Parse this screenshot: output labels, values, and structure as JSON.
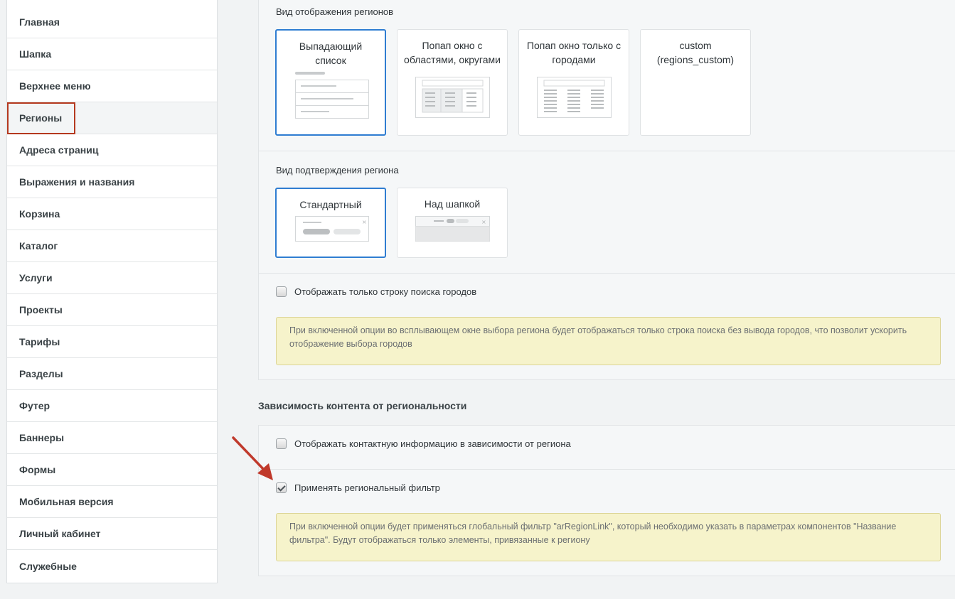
{
  "sidebar": {
    "items": [
      {
        "label": "Главная"
      },
      {
        "label": "Шапка"
      },
      {
        "label": "Верхнее меню"
      },
      {
        "label": "Регионы"
      },
      {
        "label": "Адреса страниц"
      },
      {
        "label": "Выражения и названия"
      },
      {
        "label": "Корзина"
      },
      {
        "label": "Каталог"
      },
      {
        "label": "Услуги"
      },
      {
        "label": "Проекты"
      },
      {
        "label": "Тарифы"
      },
      {
        "label": "Разделы"
      },
      {
        "label": "Футер"
      },
      {
        "label": "Баннеры"
      },
      {
        "label": "Формы"
      },
      {
        "label": "Мобильная версия"
      },
      {
        "label": "Личный кабинет"
      },
      {
        "label": "Служебные"
      }
    ],
    "active": "Регионы"
  },
  "region_view": {
    "label": "Вид отображения регионов",
    "options": [
      {
        "title": "Выпадающий список",
        "selected": true
      },
      {
        "title": "Попап окно с областями, округами",
        "selected": false
      },
      {
        "title": "Попап окно только с городами",
        "selected": false
      },
      {
        "title": "custom (regions_custom)",
        "selected": false
      }
    ]
  },
  "region_confirm": {
    "label": "Вид подтверждения региона",
    "options": [
      {
        "title": "Стандартный",
        "selected": true
      },
      {
        "title": "Над шапкой",
        "selected": false
      }
    ]
  },
  "search_only": {
    "label": "Отображать только строку поиска городов",
    "checked": false,
    "note": "При включенной опции во всплывающем окне выбора региона будет отображаться только строка поиска без вывода городов, что позволит ускорить отображение выбора городов"
  },
  "content_section": {
    "title": "Зависимость контента от региональности",
    "contact_info": {
      "label": "Отображать контактную информацию в зависимости от региона",
      "checked": false
    },
    "regional_filter": {
      "label": "Применять региональный фильтр",
      "checked": true,
      "note": "При включенной опции будет применяться глобальный фильтр \"arRegionLink\", который необходимо указать в параметрах компонентов \"Название фильтра\". Будут отображаться только элементы, привязанные к региону"
    }
  },
  "colors": {
    "selected_border": "#2f7dd1",
    "active_highlight": "#b5391f",
    "note_bg": "#f6f3cb",
    "arrow": "#c0392b"
  }
}
